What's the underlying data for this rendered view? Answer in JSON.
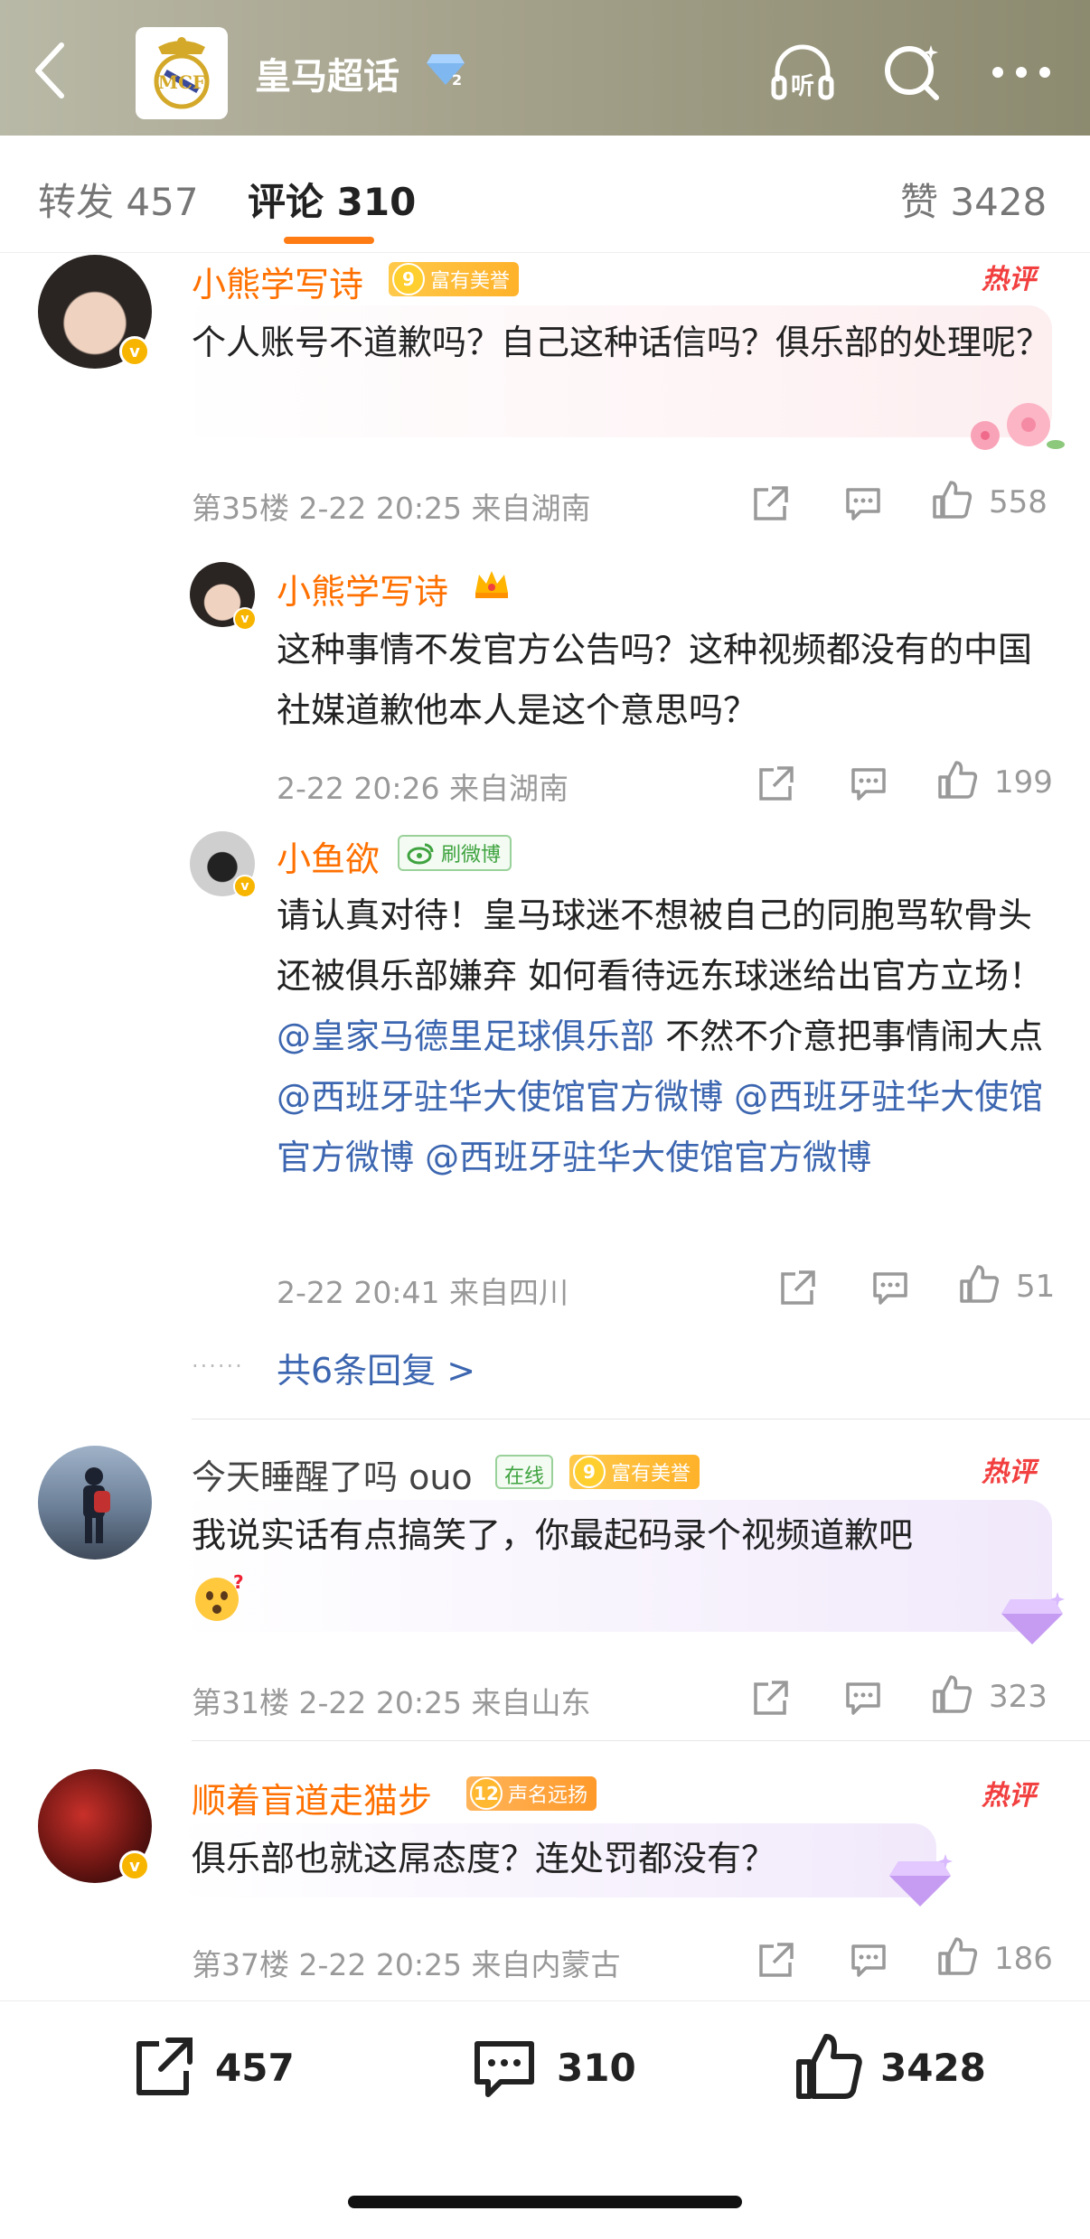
{
  "header": {
    "title": "皇马超话",
    "icons": {
      "back": "back-chevron-icon",
      "listen": "headphones-listen-icon",
      "search": "search-icon",
      "more": "more-dots-icon"
    },
    "listen_label": "听"
  },
  "tabs": {
    "repost": {
      "label": "转发",
      "count": "457"
    },
    "comments": {
      "label": "评论",
      "count": "310"
    },
    "likes": {
      "label": "赞",
      "count": "3428"
    }
  },
  "colors": {
    "accent": "#ff7000",
    "link": "#3c66b0",
    "hot": "#f23f3f",
    "vip": "#f7b500"
  },
  "comments": [
    {
      "user": "小熊学写诗",
      "medal": {
        "level": "9",
        "text": "富有美誉"
      },
      "hot_label": "热评",
      "text": "个人账号不道歉吗？自己这种话信吗？俱乐部的处理呢？",
      "floor": "第35楼",
      "time": "2-22 20:25",
      "location": "来自湖南",
      "likes": "558",
      "replies": [
        {
          "user": "小熊学写诗",
          "text": "这种事情不发官方公告吗？这种视频都没有的中国社媒道歉他本人是这个意思吗？",
          "time": "2-22 20:26",
          "location": "来自湖南",
          "likes": "199"
        },
        {
          "user": "小鱼欲",
          "badge": "刷微博",
          "text_parts": [
            "请认真对待！皇马球迷不想被自己的同胞骂软骨头还被俱乐部嫌弃 如何看待远东球迷给出官方立场！",
            "@皇家马德里足球俱乐部",
            "不然不介意把事情闹大点",
            "@西班牙驻华大使馆官方微博",
            "@西班牙驻华大使馆官方微博",
            "@西班牙驻华大使馆官方微博"
          ],
          "time": "2-22 20:41",
          "location": "来自四川",
          "likes": "51"
        }
      ],
      "more_replies": "共6条回复 >"
    },
    {
      "user": "今天睡醒了吗 ouo",
      "online": "在线",
      "medal": {
        "level": "9",
        "text": "富有美誉"
      },
      "hot_label": "热评",
      "text": "我说实话有点搞笑了，你最起码录个视频道歉吧",
      "floor": "第31楼",
      "time": "2-22 20:25",
      "location": "来自山东",
      "likes": "323"
    },
    {
      "user": "顺着盲道走猫步",
      "medal": {
        "level": "12",
        "text": "声名远扬"
      },
      "hot_label": "热评",
      "text": "俱乐部也就这屌态度？连处罚都没有？",
      "floor": "第37楼",
      "time": "2-22 20:25",
      "location": "来自内蒙古",
      "likes": "186"
    }
  ],
  "bottom": {
    "repost": "457",
    "comments": "310",
    "likes": "3428"
  }
}
